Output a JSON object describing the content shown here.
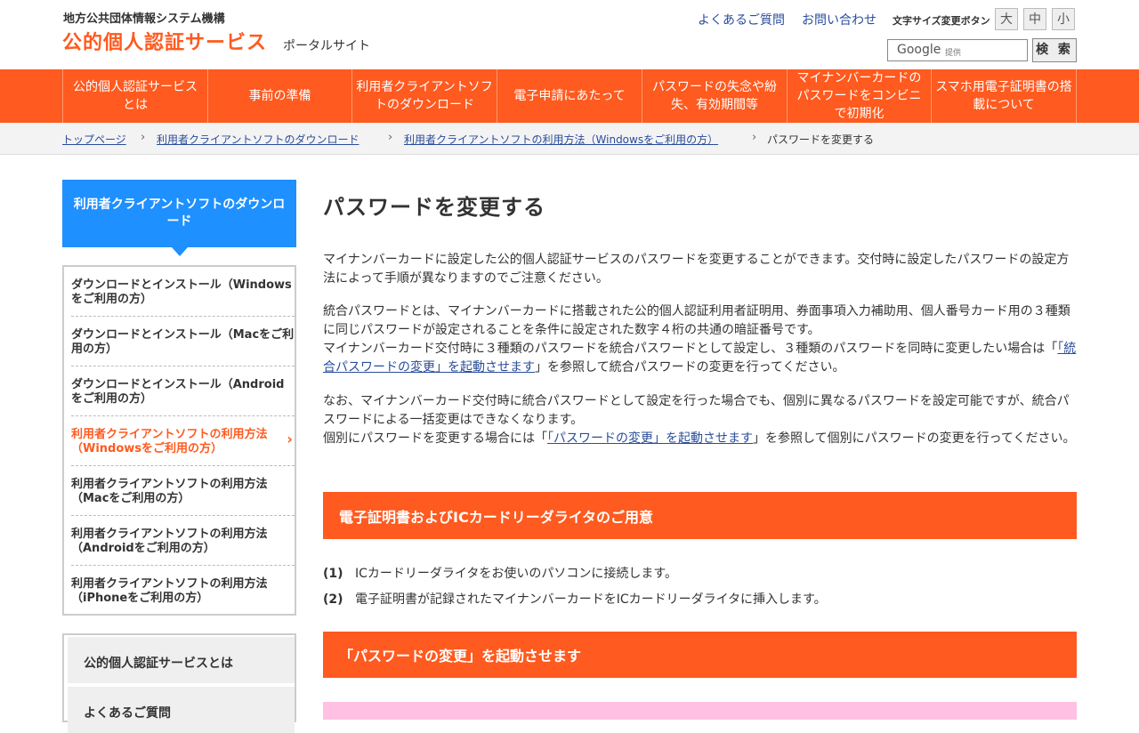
{
  "header": {
    "org": "地方公共団体情報システム機構",
    "title": "公的個人認証サービス",
    "subtitle": "ポータルサイト",
    "links": {
      "faq": "よくあるご質問",
      "contact": "お問い合わせ"
    },
    "font_size": {
      "label": "文字サイズ変更ボタン",
      "large": "大",
      "medium": "中",
      "small": "小"
    },
    "search": {
      "google": "Google",
      "provided": "提供",
      "button": "検 索"
    }
  },
  "gnav": {
    "items": [
      "公的個人認証サービスとは",
      "事前の準備",
      "利用者クライアントソフトのダウンロード",
      "電子申請にあたって",
      "パスワードの失念や紛失、有効期間等",
      "マイナンバーカードのパスワードをコンビニで初期化",
      "スマホ用電子証明書の搭載について"
    ]
  },
  "breadcrumb": {
    "items": [
      "トップページ",
      "利用者クライアントソフトのダウンロード",
      "利用者クライアントソフトの利用方法（Windowsをご利用の方）"
    ],
    "separator": "›",
    "current": "パスワードを変更する"
  },
  "sidebar": {
    "heading": "利用者クライアントソフトのダウンロード",
    "items": [
      "ダウンロードとインストール（Windowsをご利用の方）",
      "ダウンロードとインストール（Macをご利用の方）",
      "ダウンロードとインストール（Androidをご利用の方）",
      "利用者クライアントソフトの利用方法（Windowsをご利用の方）",
      "利用者クライアントソフトの利用方法（Macをご利用の方）",
      "利用者クライアントソフトの利用方法（Androidをご利用の方）",
      "利用者クライアントソフトの利用方法（iPhoneをご利用の方）"
    ],
    "active_chevron": "›",
    "box_items": [
      "公的個人認証サービスとは",
      "よくあるご質問"
    ]
  },
  "main": {
    "title": "パスワードを変更する",
    "p1": "マイナンバーカードに設定した公的個人認証サービスのパスワードを変更することができます。交付時に設定したパスワードの設定方法によって手順が異なりますのでご注意ください。",
    "p2a": "統合パスワードとは、マイナンバーカードに搭載された公的個人認証利用者証明用、券面事項入力補助用、個人番号カード用の３種類に同じパスワードが設定されることを条件に設定された数字４桁の共通の暗証番号です。",
    "p2b": "マイナンバーカード交付時に３種類のパスワードを統合パスワードとして設定し、３種類のパスワードを同時に変更したい場合は「",
    "p2_link": "「統合パスワードの変更」を起動させます",
    "p2c": "」を参照して統合パスワードの変更を行ってください。",
    "p3a": "なお、マイナンバーカード交付時に統合パスワードとして設定を行った場合でも、個別に異なるパスワードを設定可能ですが、統合パスワードによる一括変更はできなくなります。",
    "p3b": "個別にパスワードを変更する場合には「",
    "p3_link": "「パスワードの変更」を起動させます",
    "p3c": "」を参照して個別にパスワードの変更を行ってください。",
    "section1": "電子証明書およびICカードリーダライタのご用意",
    "steps": [
      {
        "num": "(1)",
        "text": "ICカードリーダライタをお使いのパソコンに接続します。"
      },
      {
        "num": "(2)",
        "text": "電子証明書が記録されたマイナンバーカードをICカードリーダライタに挿入します。"
      }
    ],
    "section2": "「パスワードの変更」を起動させます"
  },
  "colors": {
    "accent": "#ff5a1f",
    "sidebar_head": "#1e90ff",
    "link": "#2a4d9b",
    "pink": "#ffc0e3"
  }
}
